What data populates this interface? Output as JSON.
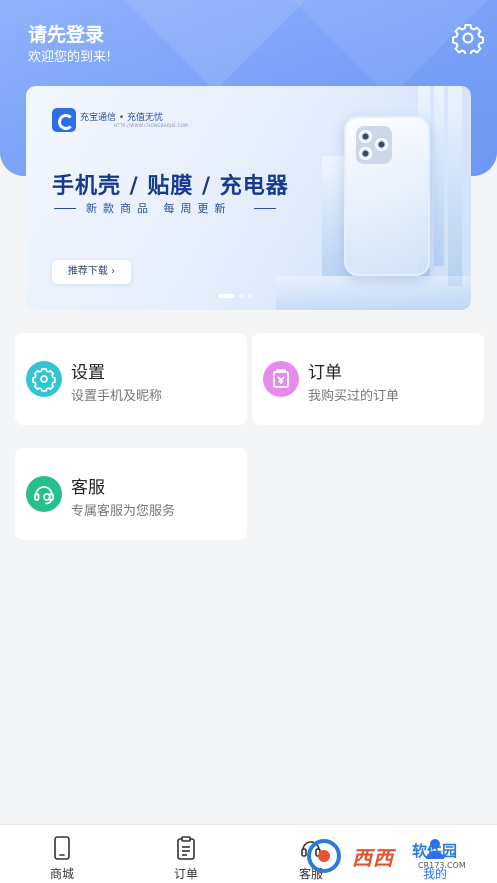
{
  "header": {
    "title": "请先登录",
    "subtitle": "欢迎您的到来!",
    "settings_icon": "gear-icon"
  },
  "banner": {
    "brand": "充宝通信 • 充值无忧",
    "brand_sub": "HTTP://WWW.CHONGBAOJIE.COM",
    "headline": "手机壳 / 贴膜 / 充电器",
    "tagline": "新款商品 每周更新",
    "button_label": "推荐下载 ›",
    "slides_total": 3,
    "slide_active": 1
  },
  "cards": [
    {
      "title": "设置",
      "desc": "设置手机及昵称",
      "icon": "settings-icon",
      "color": "#2ec6d3"
    },
    {
      "title": "订单",
      "desc": "我购买过的订单",
      "icon": "order-icon",
      "color": "#e58cea"
    },
    {
      "title": "客服",
      "desc": "专属客服为您服务",
      "icon": "customer-service-icon",
      "color": "#25c08c"
    }
  ],
  "tabbar": {
    "tabs": [
      {
        "label": "商城",
        "icon": "phone-icon"
      },
      {
        "label": "订单",
        "icon": "clipboard-icon"
      },
      {
        "label": "客服",
        "icon": "headset-icon"
      },
      {
        "label": "我的",
        "icon": "profile-icon"
      }
    ],
    "active_index": 3,
    "active_color": "#2f6cf3"
  },
  "watermark": {
    "text": "西西",
    "text2": "软件园",
    "url": "CR173.COM"
  },
  "colors": {
    "header_blue": "#7aa2f8",
    "background": "#f4f5f7"
  }
}
